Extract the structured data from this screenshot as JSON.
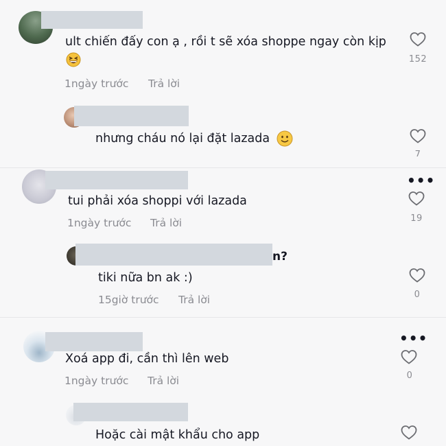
{
  "comments": [
    {
      "text_line1": "ult chiến đấy con ạ , rồi t sẽ xóa shoppe ngay còn kịp",
      "time": "1ngày trước",
      "reply": "Trả lời",
      "likes": "152",
      "emoji": "grinning-squint-face"
    },
    {
      "text": "nhưng cháu nó lại đặt lazada",
      "likes": "7",
      "emoji": "slightly-smiling-face"
    },
    {
      "text": "tui phải xóa shoppi với lazada",
      "time": "1ngày trước",
      "reply": "Trả lời",
      "likes": "19"
    },
    {
      "text": "tiki nữa bn ak :)",
      "username_trail": "n?",
      "time": "15giờ trước",
      "reply": "Trả lời",
      "likes": "0"
    },
    {
      "text": "Xoá app đi, cần thì lên web",
      "time": "1ngày trước",
      "reply": "Trả lời",
      "likes": "0"
    },
    {
      "text": "Hoặc cài mật khẩu cho app"
    }
  ],
  "more_dots": "•••"
}
